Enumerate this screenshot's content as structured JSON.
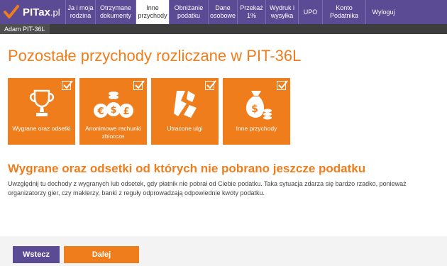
{
  "logo": {
    "brand": "PITax",
    "suffix": ".pl"
  },
  "nav": [
    {
      "label": "Ja i moja rodzina",
      "name": "nav-ja-i-moja-rodzina"
    },
    {
      "label": "Otrzymane dokumenty",
      "name": "nav-otrzymane-dokumenty"
    },
    {
      "label": "Inne przychody",
      "name": "nav-inne-przychody",
      "active": true
    },
    {
      "label": "Obniżanie podatku",
      "name": "nav-obnizanie-podatku"
    },
    {
      "label": "Dane osobowe",
      "name": "nav-dane-osobowe"
    },
    {
      "label": "Przekaż 1%",
      "name": "nav-przekaz-1"
    },
    {
      "label": "Wydruk i wysyłka",
      "name": "nav-wydruk-i-wysylka"
    },
    {
      "label": "UPO",
      "name": "nav-upo"
    },
    {
      "label": "Konto Podatnika",
      "name": "nav-konto-podatnika"
    },
    {
      "label": "Wyloguj",
      "name": "nav-wyloguj"
    }
  ],
  "user_tab": "Adam PIT-36L",
  "page_title": "Pozostałe przychody rozliczane w PIT-36L",
  "tiles": [
    {
      "label": "Wygrane oraz odsetki",
      "icon": "trophy-icon",
      "checked": true
    },
    {
      "label": "Anonimowe rachunki zbiorcze",
      "icon": "coins-icon",
      "checked": true
    },
    {
      "label": "Utracone ulgi",
      "icon": "broken-document-icon",
      "checked": true
    },
    {
      "label": "Inne przychody",
      "icon": "money-bag-icon",
      "checked": true
    }
  ],
  "section_title": "Wygrane oraz odsetki od których nie pobrano jeszcze podatku",
  "description": "Uwzględnij tu dochody z wygranych lub odsetek, gdy płatnik nie pobrał od Ciebie podatku. Taka sytuacja zdarza się bardzo rzadko, ponieważ organizatorzy gier, czy maklerzy, banki z reguły odprowadzają odpowiednie kwoty podatku.",
  "buttons": {
    "back": "Wstecz",
    "next": "Dalej"
  },
  "colors": {
    "accent": "#f07d1c",
    "nav": "#5b4a94",
    "subbar": "#3d3d3d"
  }
}
